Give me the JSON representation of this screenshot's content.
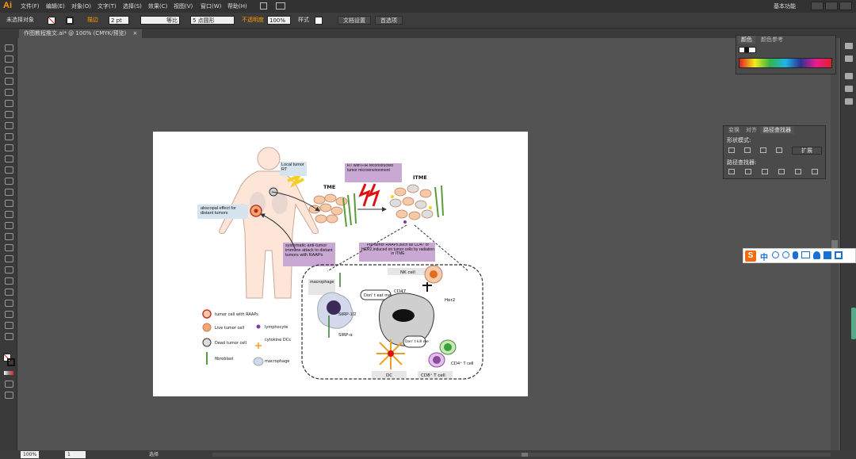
{
  "app": {
    "logo": "Ai",
    "workspace": "基本功能"
  },
  "menu": [
    "文件(F)",
    "编辑(E)",
    "对象(O)",
    "文字(T)",
    "选择(S)",
    "效果(C)",
    "视图(V)",
    "窗口(W)",
    "帮助(H)"
  ],
  "control": {
    "selection": "未选择对象",
    "stroke_label": "描边",
    "stroke_value": "2 pt",
    "stroke_style": "等比",
    "brush": "5 点圆形",
    "opacity_label": "不透明度",
    "opacity": "100%",
    "style_label": "样式",
    "doc_setup": "文档设置",
    "prefs": "首选项"
  },
  "document": {
    "tab": "作图教程推文.ai* @ 100% (CMYK/预览)",
    "close": "×"
  },
  "status": {
    "zoom": "100%",
    "page": "1",
    "tool": "选择"
  },
  "color_panel": {
    "tabs": [
      "颜色",
      "颜色参考"
    ]
  },
  "pathfinder": {
    "tabs": [
      "变换",
      "对齐",
      "路径查找器"
    ],
    "shape_modes": "形状模式:",
    "pathfinders": "路径查找器:",
    "expand": "扩展"
  },
  "colors": {
    "accent": "#ff9a00",
    "lavender": "#c9a8d4",
    "light_blue": "#d6e4f0"
  },
  "figure": {
    "local_rt": "Local tumor RT",
    "rt_fir": "RT with FIR reconstructed tumor microenvironment",
    "tme": "TME",
    "itme": "ITME",
    "abscopal": "abscopal effect for distant tumors",
    "systematic": "systematic anti-tumor immune attack to distant tumors with RAAPs",
    "pro_tumor": "Pro-tumor RAAPs,such as CD47 or HER2,induced on tumor cells by radiation in ITME",
    "nk_cell": "NK cell",
    "cd47": "CD47",
    "her2": "Her2",
    "macrophage": "macrophage",
    "dont_eat": "Don' t eat me",
    "dont_kill": "Don' t kill me",
    "sirp12": "SIRP-1/2",
    "sirpa": "SIRP-α",
    "dc": "DC",
    "cd8": "CD8⁺ T cell",
    "cd4": "CD4⁺ T cell",
    "legend": [
      {
        "label": "tumor cell with RAAPs"
      },
      {
        "label": "Live tumor cell"
      },
      {
        "label": "Dead tumor cell"
      },
      {
        "label": "fibroblast"
      },
      {
        "label": "lymphocyte"
      },
      {
        "label": "cytokine DCs"
      },
      {
        "label": "macrophage"
      }
    ]
  },
  "ime": {
    "brand": "S",
    "lang": "中"
  }
}
